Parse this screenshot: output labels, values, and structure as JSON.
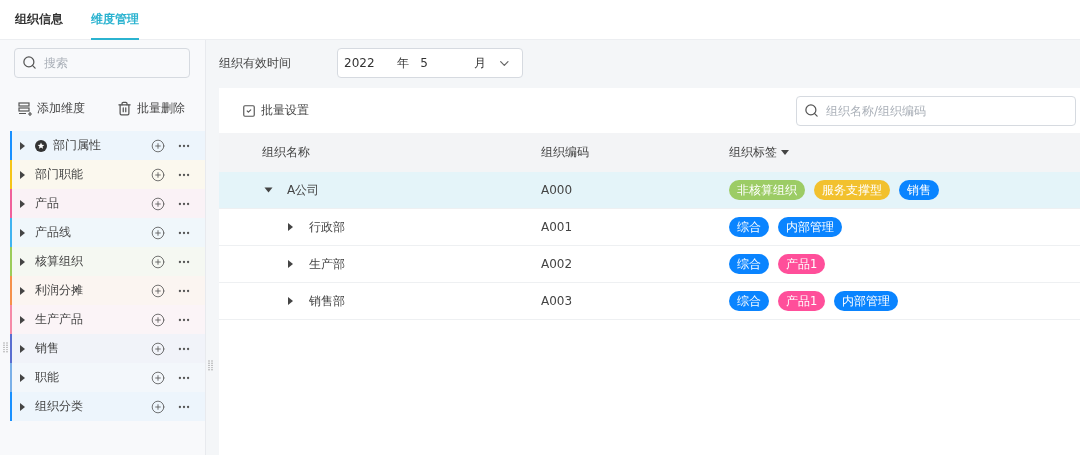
{
  "tabs": [
    {
      "label": "组织信息",
      "selected": false
    },
    {
      "label": "维度管理",
      "selected": true
    }
  ],
  "sidebar": {
    "search": {
      "placeholder": "搜索"
    },
    "actions": [
      {
        "kind": "add",
        "label": "添加维度"
      },
      {
        "kind": "delete",
        "label": "批量删除"
      }
    ],
    "items": [
      {
        "label": "部门属性",
        "color": "#1890ff",
        "starred": true
      },
      {
        "label": "部门职能",
        "color": "#f5c518",
        "starred": false
      },
      {
        "label": "产品",
        "color": "#f0609a",
        "starred": false
      },
      {
        "label": "产品线",
        "color": "#40b4f0",
        "starred": false
      },
      {
        "label": "核算组织",
        "color": "#9ccc5a",
        "starred": false
      },
      {
        "label": "利润分摊",
        "color": "#f5904a",
        "starred": false
      },
      {
        "label": "生产产品",
        "color": "#f58aa8",
        "starred": false
      },
      {
        "label": "销售",
        "color": "#5a6ed0",
        "starred": false
      },
      {
        "label": "职能",
        "color": "#7ab0e8",
        "starred": false
      },
      {
        "label": "组织分类",
        "color": "#1890ff",
        "starred": false
      }
    ]
  },
  "filter": {
    "label": "组织有效时间",
    "year": "2022",
    "year_unit": "年",
    "month": "5",
    "month_unit": "月"
  },
  "toolbar": {
    "batch_button": "批量设置",
    "search": {
      "placeholder": "组织名称/组织编码"
    }
  },
  "table": {
    "columns": [
      "组织名称",
      "组织编码",
      "组织标签"
    ],
    "rows": [
      {
        "name": "A公司",
        "code": "A000",
        "expanded": true,
        "selected": true,
        "tags": [
          {
            "label": "非核算组织",
            "color": "#9ccc65"
          },
          {
            "label": "服务支撑型",
            "color": "#f2c12e"
          },
          {
            "label": "销售",
            "color": "#0a84ff"
          }
        ],
        "children": [
          {
            "name": "行政部",
            "code": "A001",
            "expanded": false,
            "selected": false,
            "tags": [
              {
                "label": "综合",
                "color": "#0a84ff"
              },
              {
                "label": "内部管理",
                "color": "#0a84ff"
              }
            ]
          },
          {
            "name": "生产部",
            "code": "A002",
            "expanded": false,
            "selected": false,
            "tags": [
              {
                "label": "综合",
                "color": "#0a84ff"
              },
              {
                "label": "产品1",
                "color": "#ff4f9a"
              }
            ]
          },
          {
            "name": "销售部",
            "code": "A003",
            "expanded": false,
            "selected": false,
            "tags": [
              {
                "label": "综合",
                "color": "#0a84ff"
              },
              {
                "label": "产品1",
                "color": "#ff4f9a"
              },
              {
                "label": "内部管理",
                "color": "#0a84ff"
              }
            ]
          }
        ]
      }
    ]
  }
}
